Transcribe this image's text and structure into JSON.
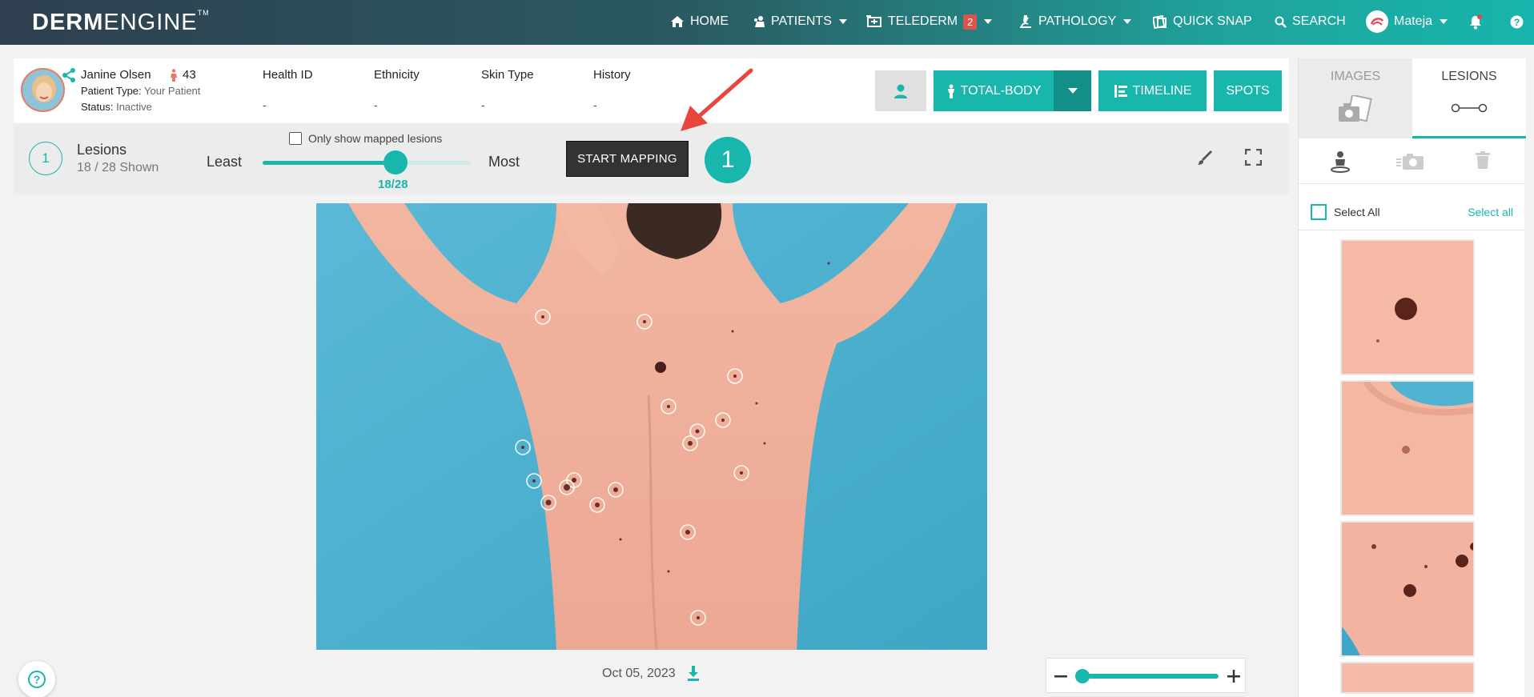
{
  "nav": {
    "logo_a": "DERM",
    "logo_b": "ENGINE",
    "logo_tm": "TM",
    "home": "HOME",
    "patients": "PATIENTS",
    "telederm": "TELEDERM",
    "telederm_badge": "2",
    "pathology": "PATHOLOGY",
    "quick_snap": "QUICK SNAP",
    "search": "SEARCH",
    "user": "Mateja"
  },
  "patient": {
    "name": "Janine Olsen",
    "age": "43",
    "type_label": "Patient Type:",
    "type_value": "Your Patient",
    "status_label": "Status:",
    "status_value": "Inactive",
    "columns": [
      {
        "header": "Health ID",
        "value": "-"
      },
      {
        "header": "Ethnicity",
        "value": "-"
      },
      {
        "header": "Skin Type",
        "value": "-"
      },
      {
        "header": "History",
        "value": "-"
      }
    ]
  },
  "actions": {
    "total_body": "TOTAL-BODY",
    "timeline": "TIMELINE",
    "spots": "SPOTS"
  },
  "lesions": {
    "count_badge": "1",
    "title": "Lesions",
    "shown": "18 / 28 Shown",
    "least": "Least",
    "most": "Most",
    "slider_value": "18/28",
    "slider_fraction": 0.64,
    "only_mapped_label": "Only show mapped lesions",
    "start_mapping": "START MAPPING",
    "step_badge": "1"
  },
  "image": {
    "date": "Oct 05, 2023",
    "zoom_fraction": 0.0
  },
  "right_panel": {
    "tab_images": "IMAGES",
    "tab_lesions": "LESIONS",
    "select_all_label": "Select All",
    "select_all_link": "Select all"
  },
  "colors": {
    "accent": "#18b6ac",
    "arrow": "#e8453c"
  }
}
